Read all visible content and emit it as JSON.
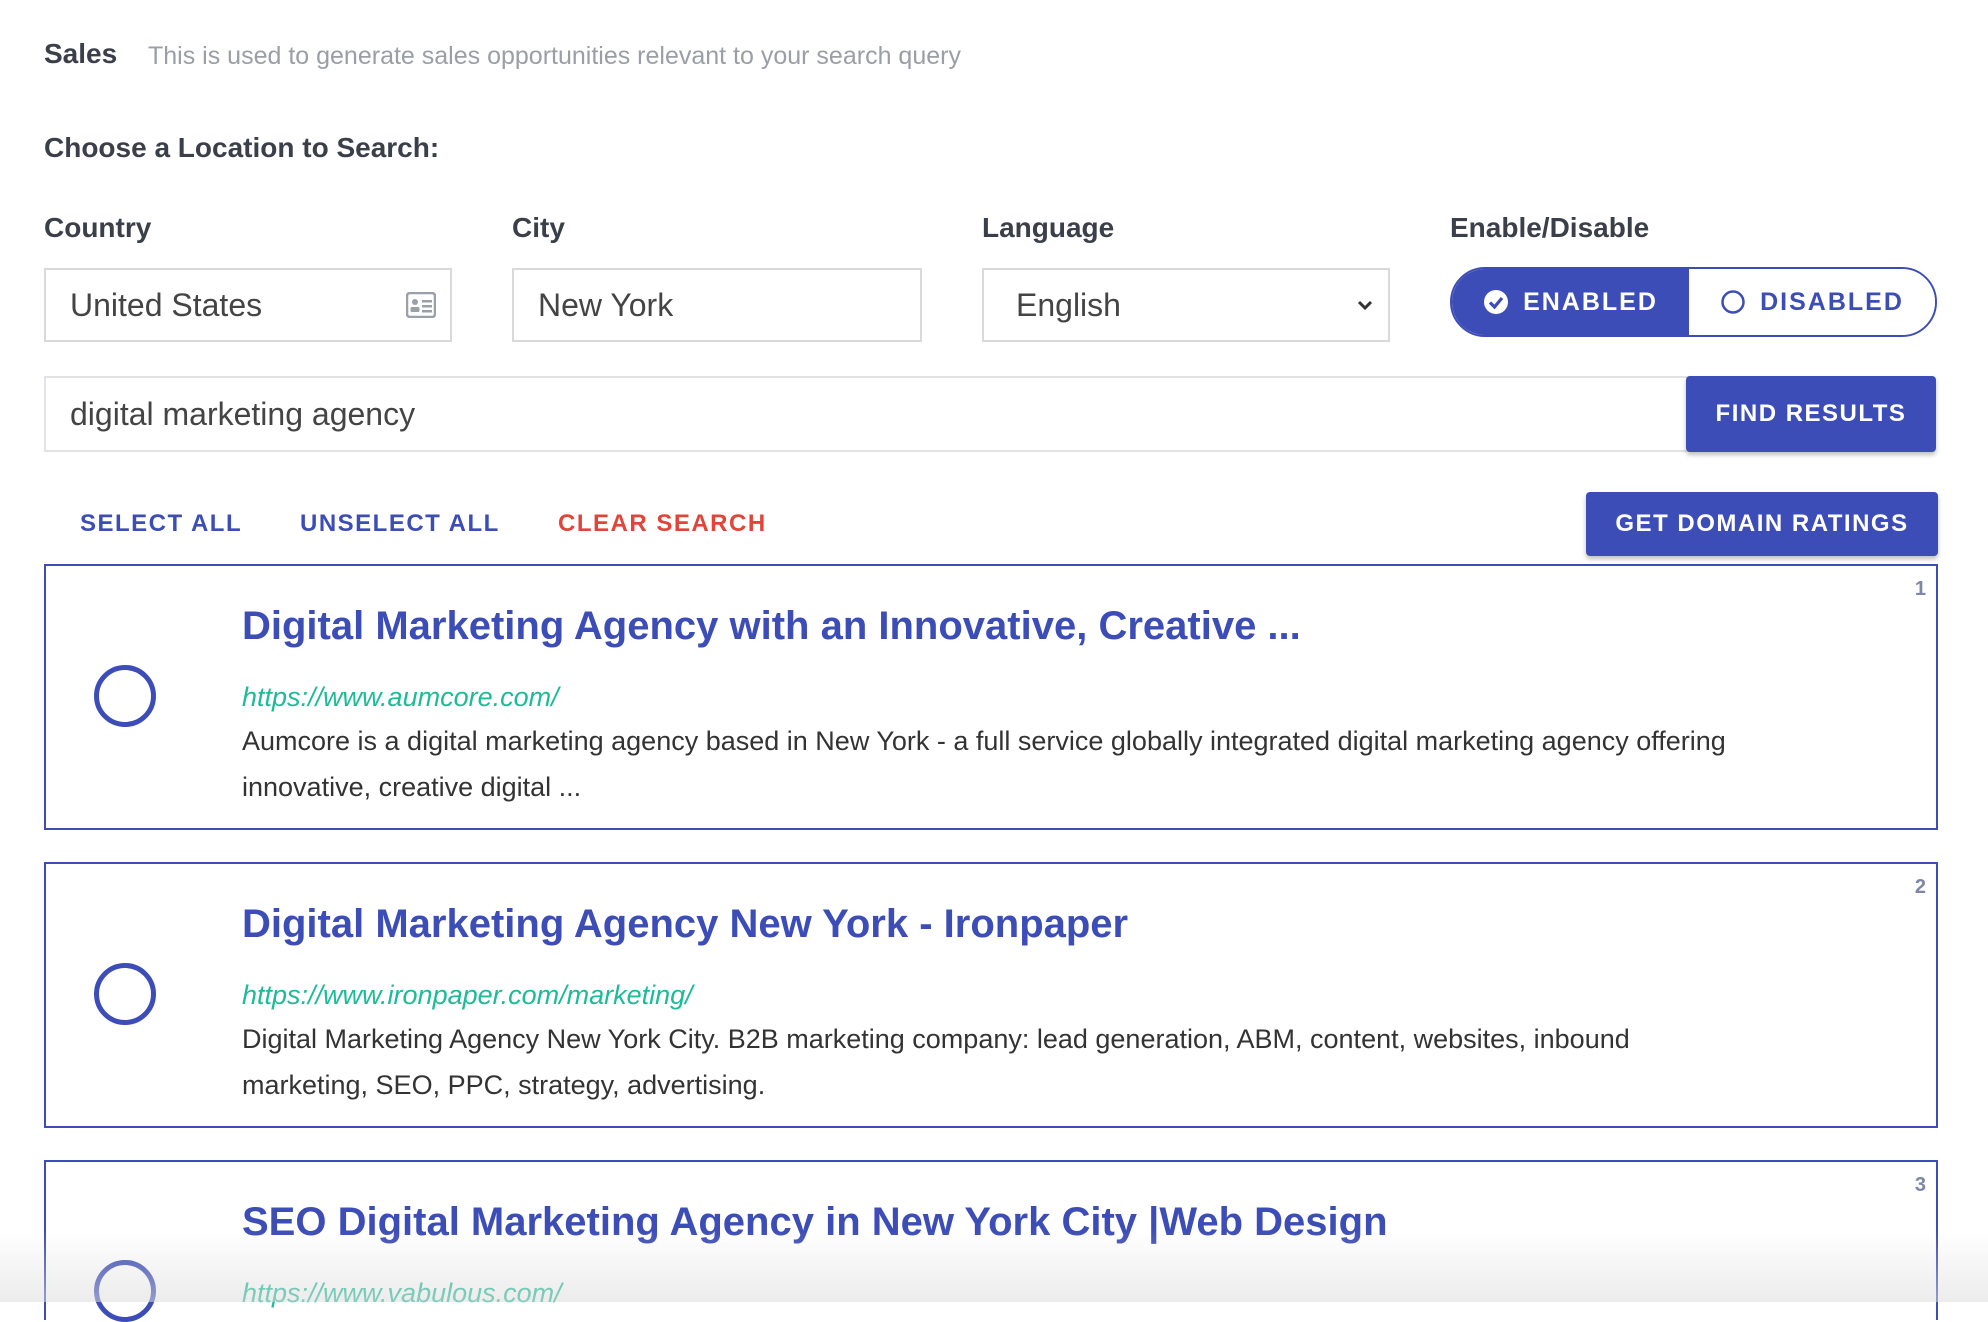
{
  "header": {
    "title": "Sales",
    "description": "This is used to generate sales opportunities relevant to your search query"
  },
  "location": {
    "heading": "Choose a Location to Search:",
    "country_label": "Country",
    "country_value": "United States",
    "city_label": "City",
    "city_value": "New York",
    "language_label": "Language",
    "language_value": "English",
    "toggle_label": "Enable/Disable",
    "enabled_label": "ENABLED",
    "disabled_label": "DISABLED",
    "selected": "ENABLED"
  },
  "search": {
    "query": "digital marketing agency",
    "find_label": "FIND RESULTS"
  },
  "actions": {
    "select_all": "SELECT ALL",
    "unselect_all": "UNSELECT ALL",
    "clear_search": "CLEAR SEARCH",
    "domain_ratings": "GET DOMAIN RATINGS"
  },
  "results": [
    {
      "rank": "1",
      "title": "Digital Marketing Agency with an Innovative, Creative ...",
      "url": "https://www.aumcore.com/",
      "description": "Aumcore is a digital marketing agency based in New York - a full service globally integrated digital marketing agency offering innovative, creative digital ..."
    },
    {
      "rank": "2",
      "title": "Digital Marketing Agency New York - Ironpaper",
      "url": "https://www.ironpaper.com/marketing/",
      "description": "Digital Marketing Agency New York City. B2B marketing company: lead generation, ABM, content, websites, inbound marketing, SEO, PPC, strategy, advertising."
    },
    {
      "rank": "3",
      "title": "SEO Digital Marketing Agency in New York City |Web Design",
      "url": "https://www.vabulous.com/",
      "description": ""
    }
  ],
  "colors": {
    "primary": "#3d4db7",
    "url": "#1dbb98",
    "danger": "#e0453a"
  }
}
